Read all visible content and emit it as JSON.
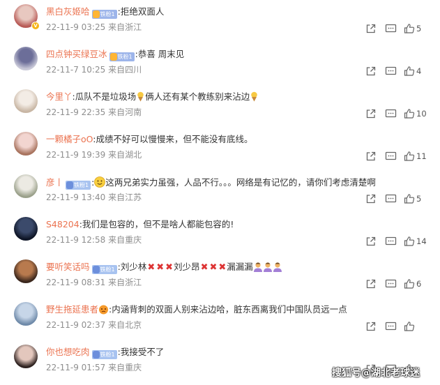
{
  "comments": [
    {
      "username": "黑白灰姬哈",
      "badge": "铁粉1",
      "text_parts": [
        ":拒绝双面人"
      ],
      "time": "22-11-9 03:25",
      "location": "来自浙江",
      "likes": "5",
      "verified": true,
      "avatar_colors": [
        "#e8c8c0",
        "#b85a56"
      ]
    },
    {
      "username": "四点钟买绿豆冰",
      "badge": "铁粉1",
      "text_parts": [
        ":恭喜  周末见"
      ],
      "time": "22-11-7 10:25",
      "location": "来自四川",
      "likes": "4",
      "verified": false,
      "avatar_colors": [
        "#6c6e99",
        "#c9c9d8"
      ]
    },
    {
      "username": "今里丫",
      "badge": "",
      "text_parts": [
        ":瓜队不是垃圾场",
        "俩人还有某个教练别来沾边"
      ],
      "time": "22-11-9 22:35",
      "location": "来自河南",
      "likes": "10",
      "verified": false,
      "avatar_colors": [
        "#f3ece5",
        "#c8b6a4"
      ]
    },
    {
      "username": "一颗橘子oO",
      "badge": "",
      "text_parts": [
        ":成绩不好可以慢慢来，但不能没有底线。"
      ],
      "time": "22-11-9 19:39",
      "location": "来自湖北",
      "likes": "11",
      "verified": false,
      "avatar_colors": [
        "#f2d5d0",
        "#a8735e"
      ]
    },
    {
      "username": "彦丨",
      "badge": "铁粉1",
      "text_parts": [
        ":",
        "这两兄弟实力虽强，人品不行。。。网络是有记忆的，请你们考虑清楚啊"
      ],
      "time": "22-11-9 13:40",
      "location": "来自江苏",
      "likes": "5",
      "verified": false,
      "avatar_colors": [
        "#eceae3",
        "#9aa08a"
      ]
    },
    {
      "username": "S48204",
      "badge": "",
      "text_parts": [
        ":我们是包容的，但不是啥人都能包容的!"
      ],
      "time": "22-11-9 12:58",
      "location": "来自重庆",
      "likes": "14",
      "verified": false,
      "avatar_colors": [
        "#3b4a6b",
        "#0e1526"
      ]
    },
    {
      "username": "要听笑话吗",
      "badge": "铁粉1",
      "text_parts": [
        ":刘少林",
        "刘少昂",
        "漏漏漏"
      ],
      "time": "22-11-9 08:31",
      "location": "来自浙江",
      "likes": "6",
      "verified": false,
      "avatar_colors": [
        "#b87a4e",
        "#3a261c"
      ]
    },
    {
      "username": "野生拖延患者",
      "badge": "",
      "text_parts": [
        ":内涵背刺的双面人别来沾边哈，脏东西离我们中国队员远一点"
      ],
      "time": "22-11-9 02:37",
      "location": "来自北京",
      "likes": "",
      "verified": false,
      "avatar_colors": [
        "#c7d6e8",
        "#6f8aa9"
      ]
    },
    {
      "username": "你也想吃肉",
      "badge": "铁粉1",
      "text_parts": [
        ":我接受不了"
      ],
      "time": "22-11-9 01:57",
      "location": "来自重庆",
      "likes": "",
      "verified": false,
      "avatar_colors": [
        "#e3c7bd",
        "#2e2220"
      ]
    }
  ],
  "watermark": "搜狐号@湖北老球迷",
  "colors": {
    "username": "#eb7350",
    "meta": "#8e8e8e",
    "icon": "#666666"
  }
}
